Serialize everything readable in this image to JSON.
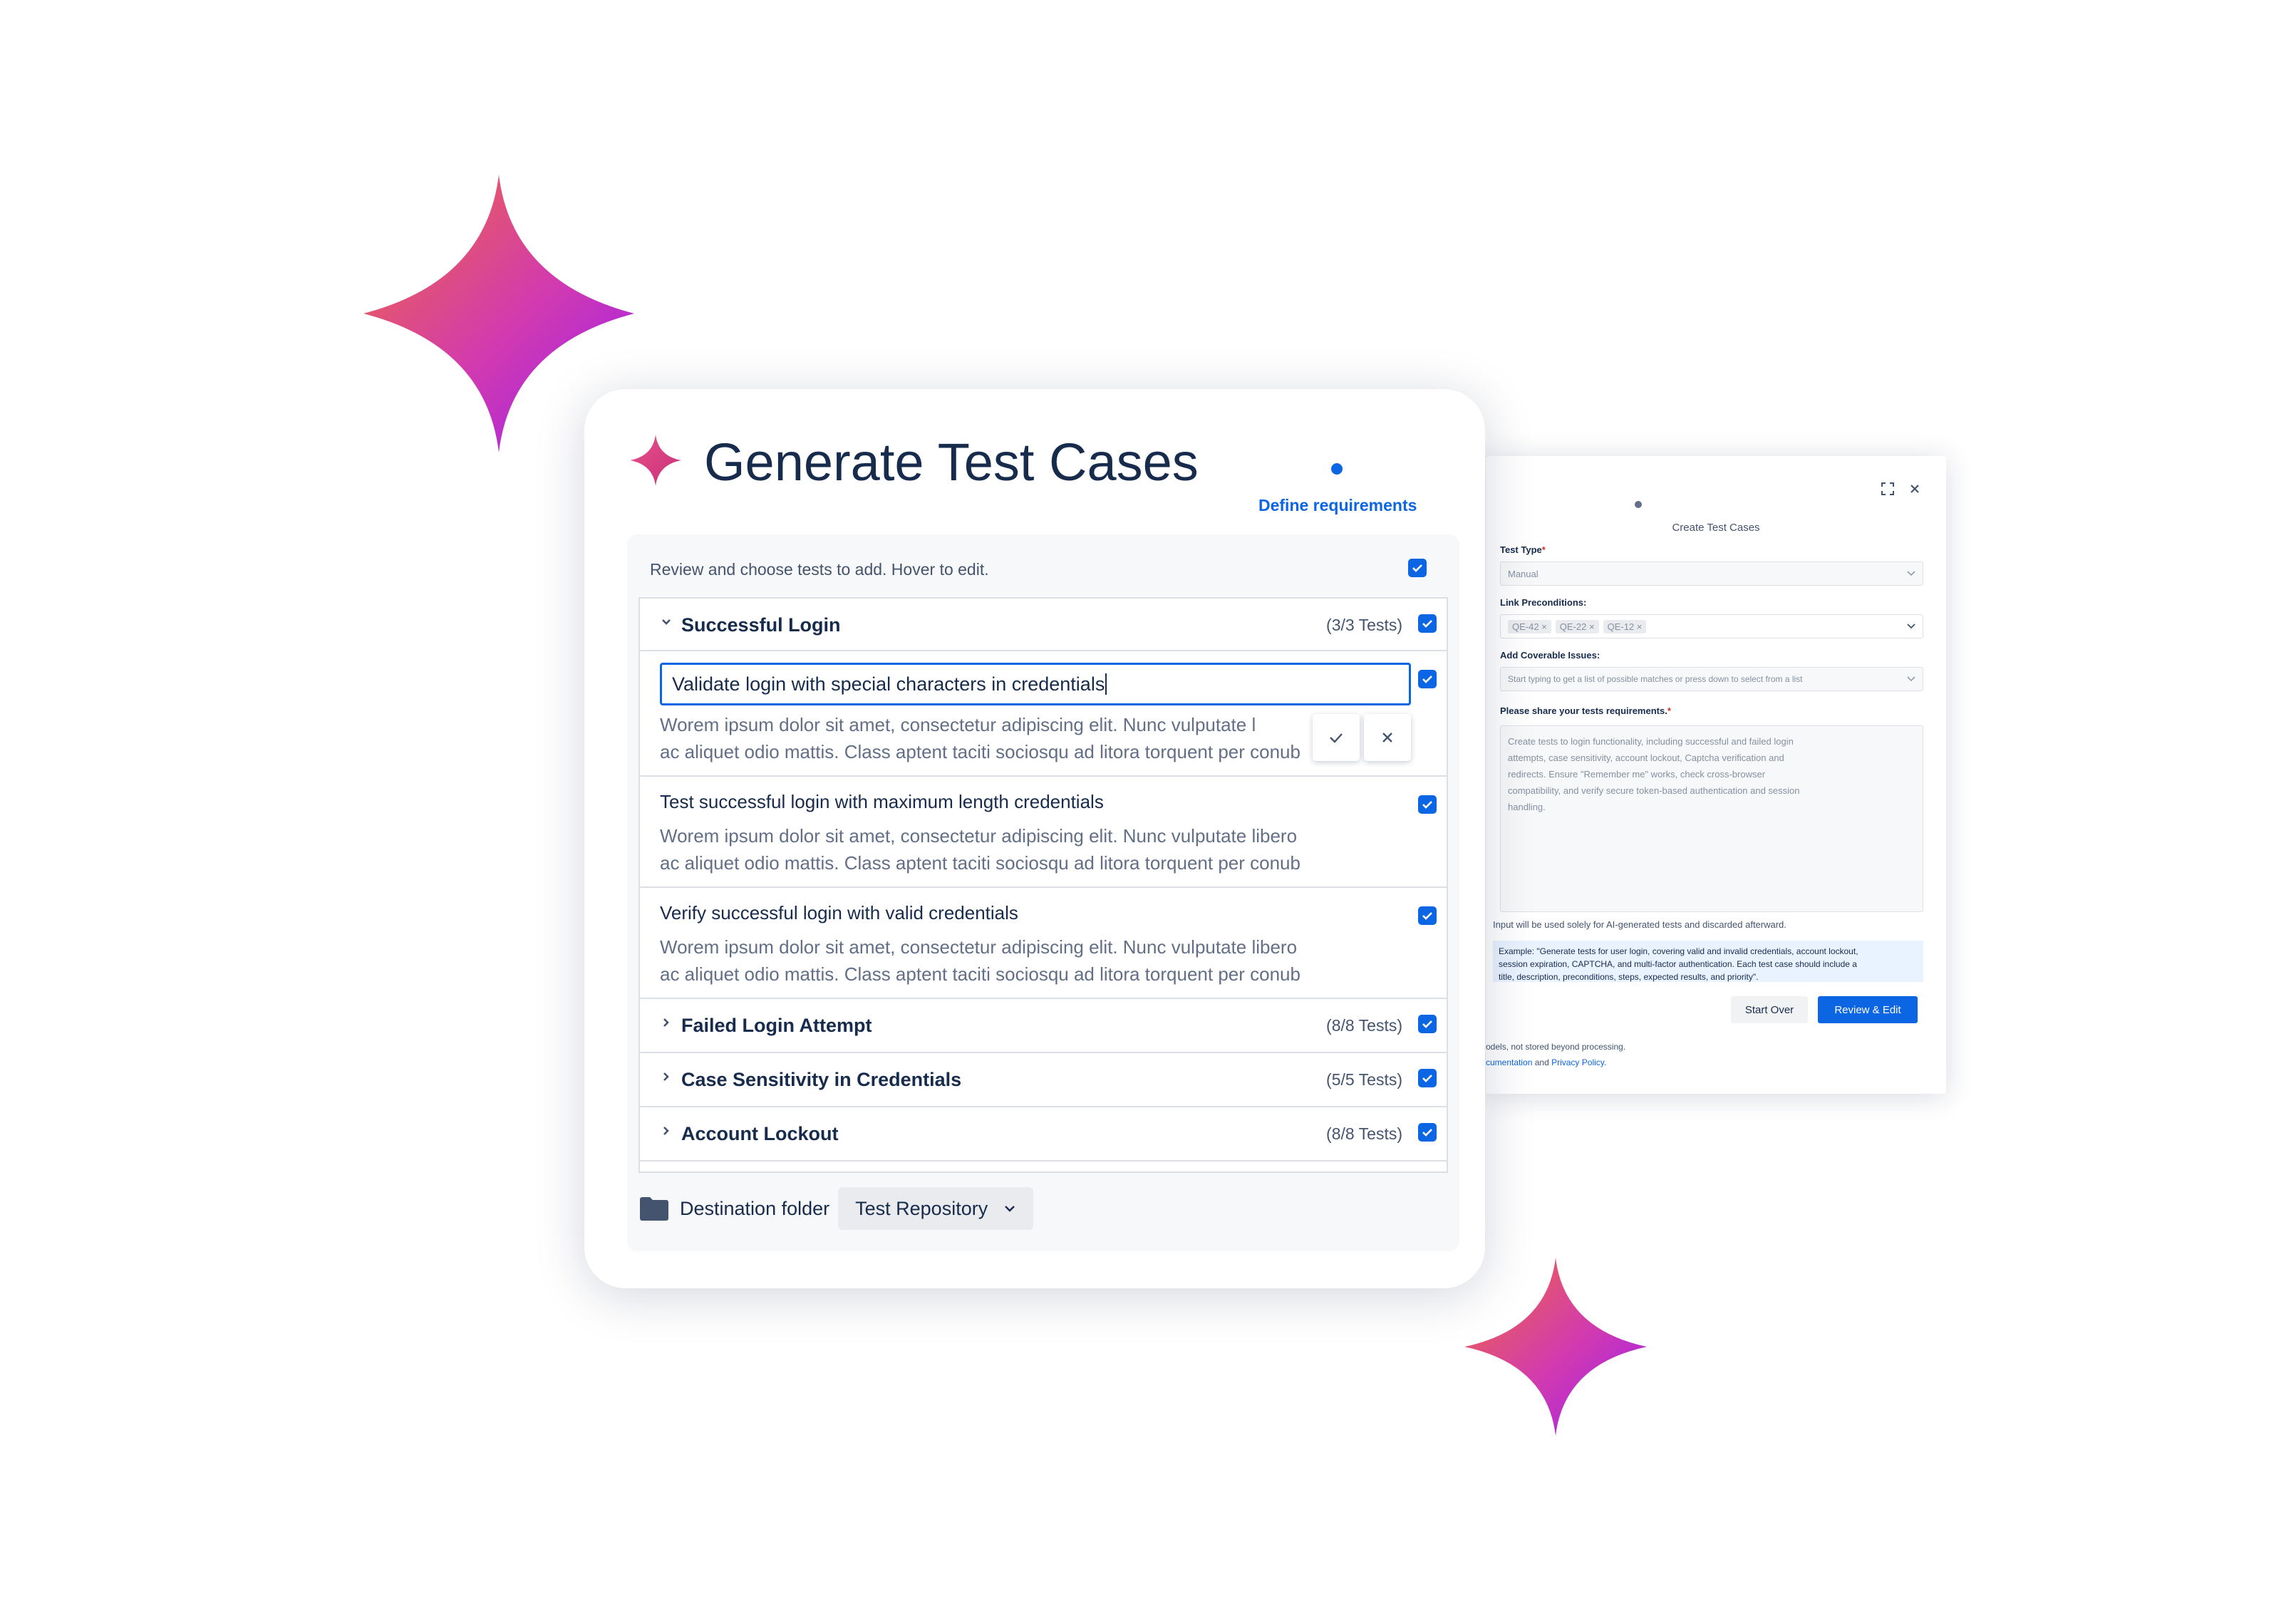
{
  "main_panel": {
    "title": "Generate Test Cases",
    "step_label": "Define requirements",
    "hint": "Review and choose tests to add. Hover to edit.",
    "groups": [
      {
        "name": "Successful Login",
        "count": "(3/3 Tests)",
        "expanded": true
      },
      {
        "name": "Failed Login Attempt",
        "count": "(8/8 Tests)",
        "expanded": false
      },
      {
        "name": "Case Sensitivity in Credentials",
        "count": "(5/5 Tests)",
        "expanded": false
      },
      {
        "name": "Account Lockout",
        "count": "(8/8 Tests)",
        "expanded": false
      }
    ],
    "tests": [
      {
        "title": "Validate login with special characters in credentials",
        "description": "Worem ipsum dolor sit amet, consectetur adipiscing elit. Nunc vulputate libero ac aliquet odio mattis. Class aptent taciti sociosqu ad litora torquent per conub",
        "editing": true
      },
      {
        "title": "Test successful login with maximum length credentials",
        "description": "Worem ipsum dolor sit amet, consectetur adipiscing elit. Nunc vulputate libero ac aliquet odio mattis. Class aptent taciti sociosqu ad litora torquent per conub"
      },
      {
        "title": "Verify successful login with valid credentials",
        "description": "Worem ipsum dolor sit amet, consectetur adipiscing elit. Nunc vulputate libero ac aliquet odio mattis. Class aptent taciti sociosqu ad litora torquent per conub"
      }
    ],
    "desc_lines": [
      [
        "Worem ipsum dolor sit amet, consectetur adipiscing elit. Nunc vulputate l",
        "ac aliquet odio mattis. Class aptent taciti sociosqu ad litora torquent per conub"
      ],
      [
        "Worem ipsum dolor sit amet, consectetur adipiscing elit. Nunc vulputate libero",
        "ac aliquet odio mattis. Class aptent taciti sociosqu ad litora torquent per conub"
      ],
      [
        "Worem ipsum dolor sit amet, consectetur adipiscing elit. Nunc vulputate libero",
        "ac aliquet odio mattis. Class aptent taciti sociosqu ad litora torquent per conub"
      ]
    ],
    "destination": {
      "label": "Destination folder",
      "value": "Test Repository"
    }
  },
  "back_panel": {
    "title": "Create Test Cases",
    "test_type_label": "Test Type",
    "test_type_value": "Manual",
    "preconditions_label": "Link Preconditions:",
    "preconditions": [
      "QE-42",
      "QE-22",
      "QE-12"
    ],
    "coverable_label": "Add Coverable Issues:",
    "coverable_placeholder": "Start typing to get a list of possible matches or press down to select from a list",
    "requirements_label": "Please share your tests requirements.",
    "requirements_lines": [
      "Create tests to login functionality, including successful and failed login",
      "attempts, case sensitivity, account lockout, Captcha verification and",
      "redirects. Ensure \"Remember me\" works, check cross-browser",
      "compatibility, and verify secure token-based authentication and session",
      "handling."
    ],
    "note": "Input will be used solely for AI-generated tests and discarded afterward.",
    "example_lines": [
      "Example: \"Generate tests for user login, covering valid and invalid credentials, account lockout,",
      "session expiration, CAPTCHA, and multi-factor authentication. Each test case should include a",
      "title, description, preconditions, steps, expected results, and priority\"."
    ],
    "start_over": "Start Over",
    "review_edit": "Review & Edit",
    "footer_line1": "odels, not stored beyond processing.",
    "footer_link1": "cumentation",
    "footer_and": "and",
    "footer_link2": "Privacy Policy."
  },
  "colors": {
    "accent": "#0c66e4",
    "sparkle_start": "#f26a3d",
    "sparkle_end": "#a21ee8"
  }
}
